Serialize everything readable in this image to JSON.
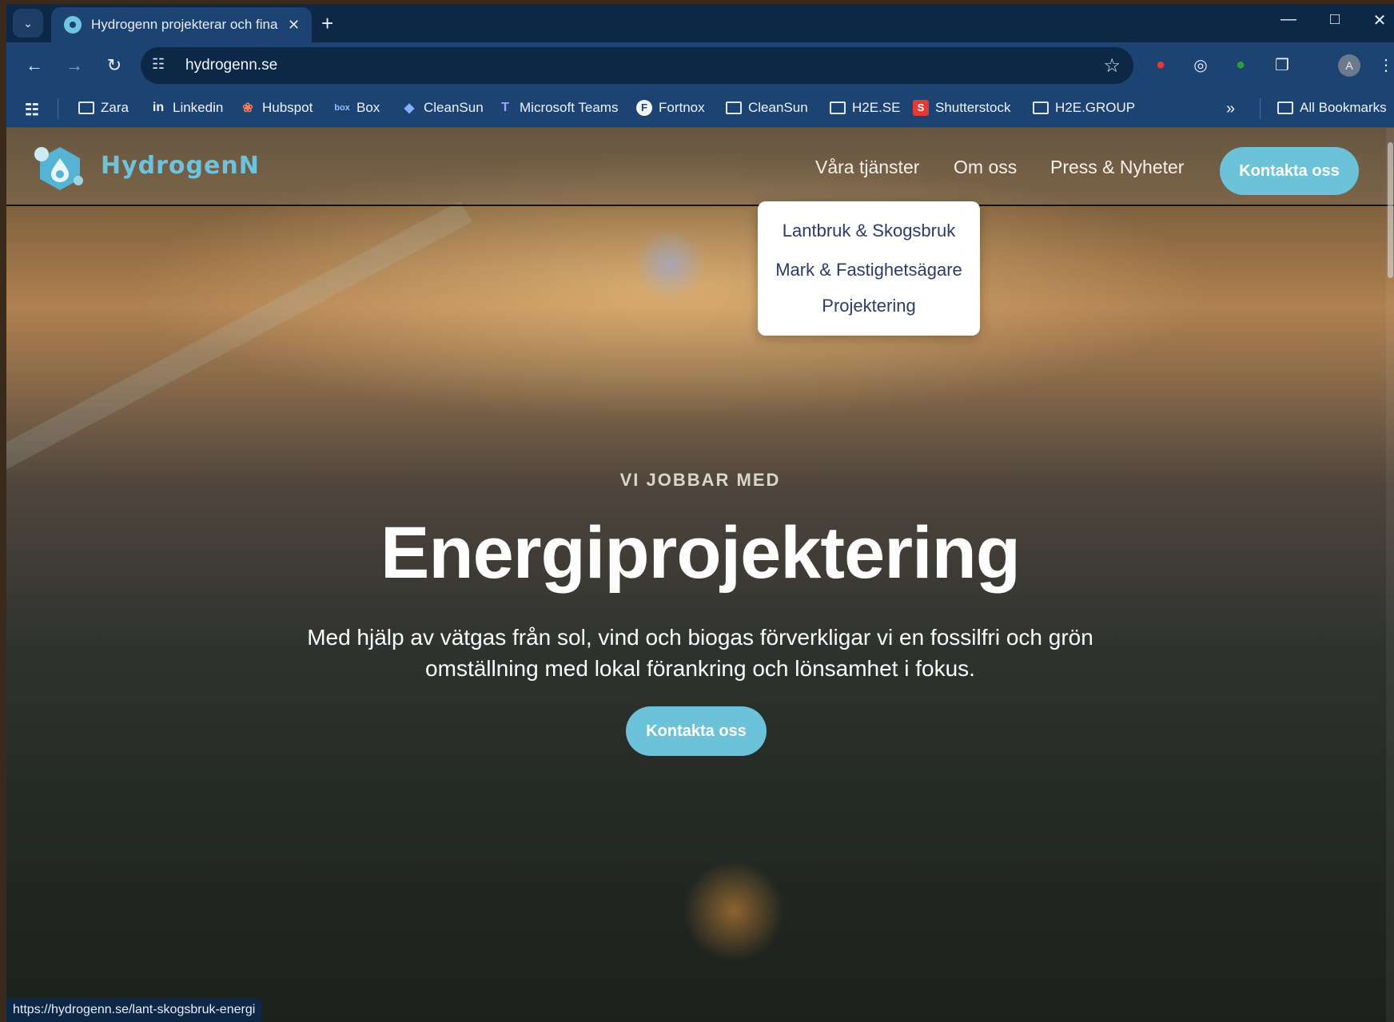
{
  "browser": {
    "tab_title": "Hydrogenn projekterar och fina",
    "tab_close": "✕",
    "new_tab": "+",
    "url": "hydrogenn.se",
    "profile_initial": "A",
    "status_url": "https://hydrogenn.se/lant-skogsbruk-energi",
    "accent": "#1c4372"
  },
  "bookmarks": {
    "items": [
      {
        "label": "Zara",
        "icon": "folder-icon"
      },
      {
        "label": "Linkedin",
        "icon": "linkedin-icon"
      },
      {
        "label": "Hubspot",
        "icon": "hubspot-icon"
      },
      {
        "label": "Box",
        "icon": "box-icon"
      },
      {
        "label": "CleanSun",
        "icon": "dropbox-icon"
      },
      {
        "label": "Microsoft Teams",
        "icon": "teams-icon"
      },
      {
        "label": "Fortnox",
        "icon": "fortnox-icon"
      },
      {
        "label": "CleanSun",
        "icon": "folder-icon"
      },
      {
        "label": "H2E.SE",
        "icon": "folder-icon"
      },
      {
        "label": "Shutterstock",
        "icon": "shutterstock-icon"
      },
      {
        "label": "H2E.GROUP",
        "icon": "folder-icon"
      }
    ],
    "more": "»",
    "all_bookmarks": "All Bookmarks"
  },
  "site": {
    "logo_text": "HydrogenN",
    "brand_color": "#6bc2d9",
    "nav": {
      "services": "Våra tjänster",
      "about": "Om oss",
      "press": "Press & Nyheter",
      "contact": "Kontakta oss"
    },
    "dropdown": [
      "Lantbruk & Skogsbruk",
      "Mark & Fastighetsägare",
      "Projektering"
    ],
    "hero": {
      "kicker": "VI JOBBAR MED",
      "title": "Energiprojektering",
      "text": "Med hjälp av vätgas från sol, vind och biogas förverkligar vi en fossilfri och grön omställning med lokal förankring och lönsamhet i fokus.",
      "cta": "Kontakta oss"
    }
  }
}
